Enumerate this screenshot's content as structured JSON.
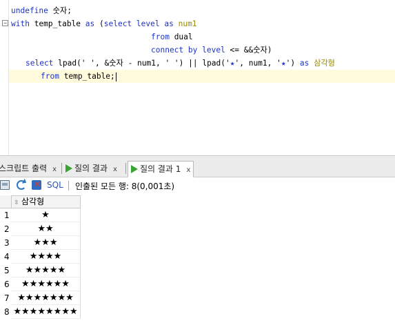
{
  "editor": {
    "fold_marker": "⊟",
    "lines": {
      "l1": {
        "kw1": "undefine",
        "rest": " 숫자;"
      },
      "l2": {
        "kw1": "with",
        "sp1": " temp_table ",
        "kw2": "as",
        "sp2": " (",
        "kw3": "select",
        "sp3": " ",
        "kw4": "level",
        "sp4": " ",
        "kw5": "as",
        "sp5": " ",
        "alias": "num1"
      },
      "l3": {
        "kw1": "from",
        "rest": " dual"
      },
      "l4": {
        "kw1": "connect by",
        "sp1": " ",
        "kw2": "level",
        "rest": " <= &&숫자)"
      },
      "l5": {
        "kw1": "select",
        "p1": " lpad(' ', &숫자 - num1, ' ') || lpad('",
        "star1": "★",
        "p2": "', num1, '",
        "star2": "★",
        "p3": "') ",
        "kw2": "as",
        "sp": " ",
        "alias": "삼각형"
      },
      "l6": {
        "kw1": "from",
        "rest": " temp_table;"
      }
    }
  },
  "tabs": [
    {
      "label": "스크립트 출력",
      "close": "x"
    },
    {
      "label": "질의 결과",
      "close": "x"
    },
    {
      "label": "질의 결과 1",
      "close": "x"
    }
  ],
  "toolbar": {
    "sql_label": "SQL",
    "fetch_status": "인출된 모든 행: 8(0,001초)"
  },
  "grid": {
    "column_header": "삼각형",
    "sort_icon": "⇳",
    "rows": [
      {
        "num": "1",
        "value": "★"
      },
      {
        "num": "2",
        "value": "★★"
      },
      {
        "num": "3",
        "value": "★★★"
      },
      {
        "num": "4",
        "value": "★★★★"
      },
      {
        "num": "5",
        "value": "★★★★★"
      },
      {
        "num": "6",
        "value": "★★★★★★"
      },
      {
        "num": "7",
        "value": "★★★★★★★"
      },
      {
        "num": "8",
        "value": "★★★★★★★★"
      }
    ]
  },
  "icons": {
    "print": "print-icon",
    "refresh": "refresh-icon",
    "cancel": "cancel-fetch-icon",
    "run": "run-icon"
  },
  "colors": {
    "keyword": "#1f33c4",
    "alias": "#9a8a00",
    "run_green": "#3aa335",
    "current_line": "#fffbdc"
  }
}
